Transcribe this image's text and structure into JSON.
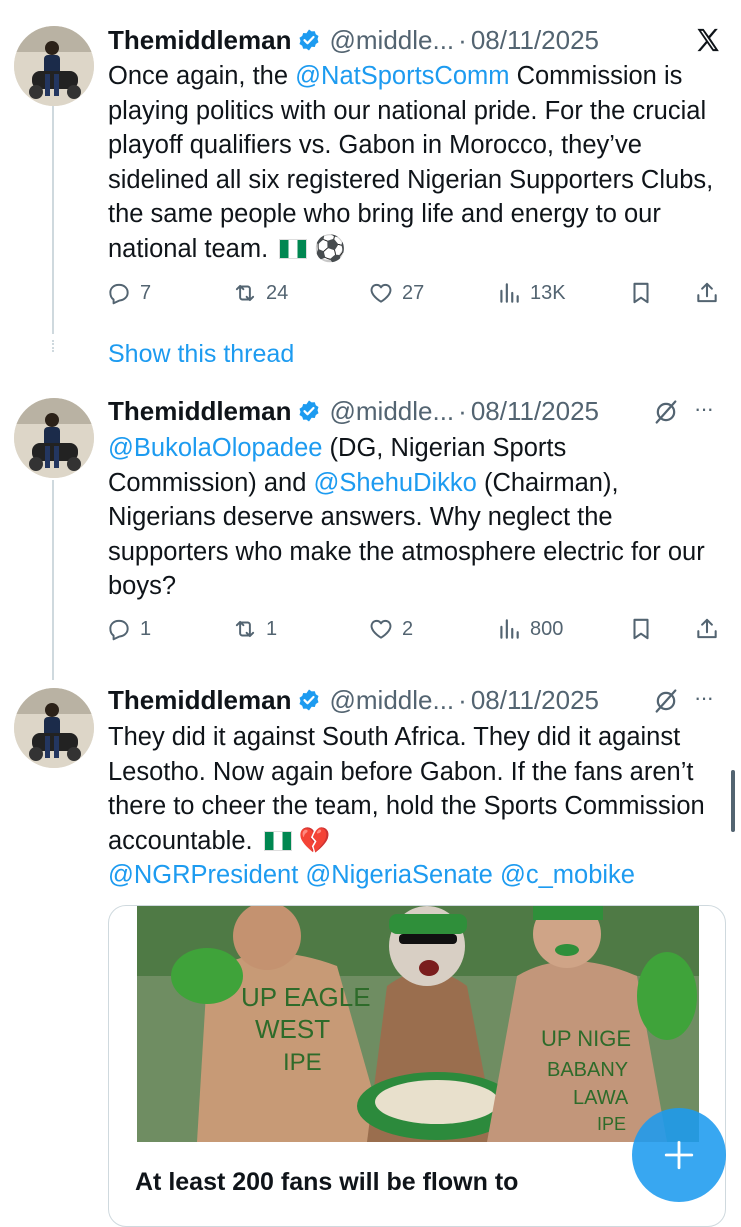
{
  "colors": {
    "accent": "#1d9bf0",
    "text": "#0f1419",
    "secondary": "#536471",
    "thread_line": "#cfd9de"
  },
  "icons": [
    "x-logo-icon",
    "verified-badge-icon",
    "reply-icon",
    "retweet-icon",
    "like-icon",
    "views-icon",
    "bookmark-icon",
    "share-icon",
    "grok-icon",
    "more-icon",
    "compose-plus-icon"
  ],
  "show_thread_label": "Show this thread",
  "tweets": [
    {
      "name": "Themiddleman",
      "handle": "@middle...",
      "separator": "·",
      "date": "08/11/2025",
      "text": {
        "p1": "Once again, the ",
        "m1": "@NatSportsComm",
        "p2": " Commission is playing politics with our national pride. For the crucial playoff qualifiers vs. Gabon in Morocco, they’ve sidelined all six registered Nigerian Supporters Clubs, the same people who bring life and energy to our national team. ",
        "emoji2": "⚽"
      },
      "stats": {
        "replies": "7",
        "retweets": "24",
        "likes": "27",
        "views": "13K"
      }
    },
    {
      "name": "Themiddleman",
      "handle": "@middle...",
      "separator": "·",
      "date": "08/11/2025",
      "more": "···",
      "text": {
        "m1": "@BukolaOlopadee",
        "p1": " (DG, Nigerian Sports Commission) and ",
        "m2": "@ShehuDikko",
        "p2": " (Chairman), Nigerians deserve answers. Why neglect the supporters who make the atmosphere electric for our boys?"
      },
      "stats": {
        "replies": "1",
        "retweets": "1",
        "likes": "2",
        "views": "800"
      }
    },
    {
      "name": "Themiddleman",
      "handle": "@middle...",
      "separator": "·",
      "date": "08/11/2025",
      "more": "···",
      "text": {
        "p1": "They did it against South Africa. They did it against Lesotho. Now again before Gabon. If the fans aren’t there to cheer the team, hold the Sports Commission accountable. ",
        "emoji2": "💔",
        "m1": "@NGRPresident",
        "m2": "@NigeriaSenate",
        "m3": "@c_mobike"
      },
      "card": {
        "image_text_left": "UP EAGLE",
        "image_text_left2": "WEST",
        "image_text_left3": "IPE",
        "image_text_right": "UP NIGE",
        "image_text_right2": "BABANY",
        "image_text_right3": "LAWA",
        "image_text_right4": "IPE",
        "title": "At least 200 fans will be flown to"
      }
    }
  ]
}
